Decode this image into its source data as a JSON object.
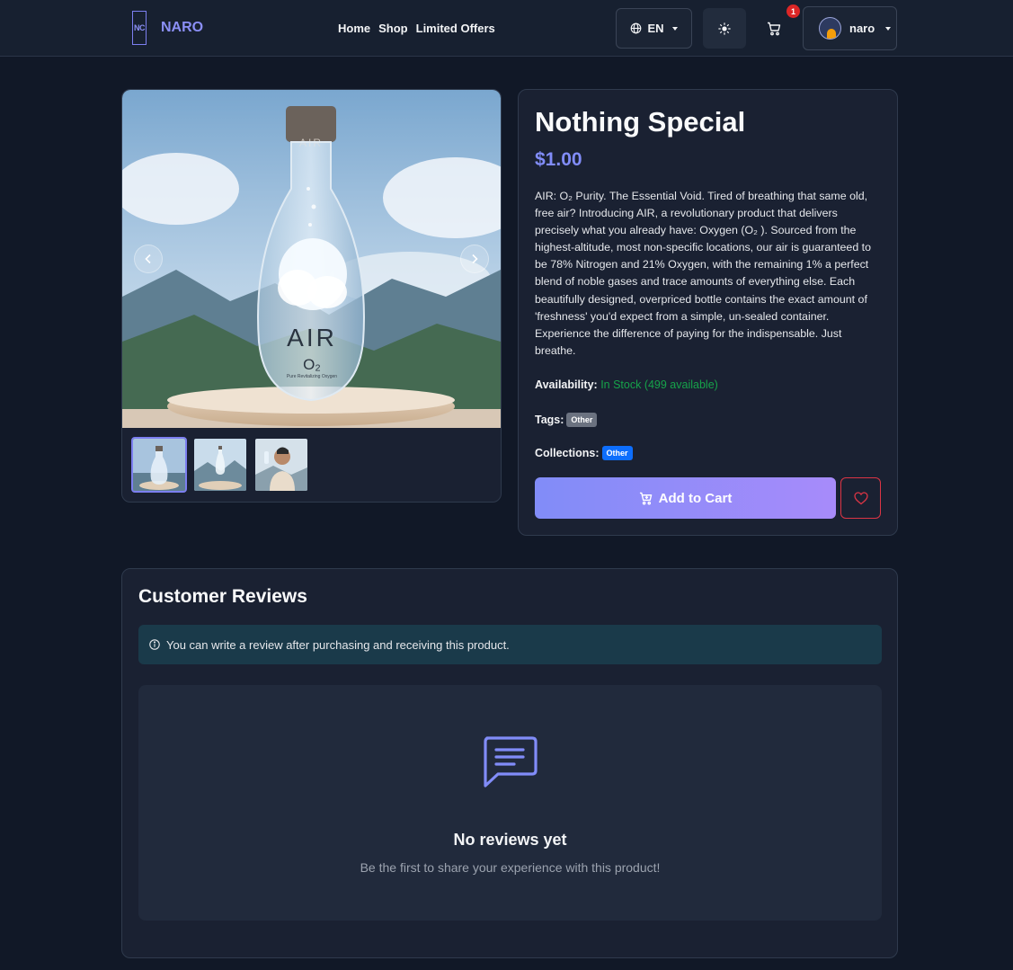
{
  "nav": {
    "logo_text": "NC",
    "brand": "NARO",
    "links": [
      "Home",
      "Shop",
      "Limited Offers"
    ],
    "language": "EN",
    "cart_count": "1",
    "username": "naro"
  },
  "product": {
    "title": "Nothing Special",
    "price": "$1.00",
    "description": "AIR: O₂ Purity. The Essential Void. Tired of breathing that same old, free air? Introducing AIR, a revolutionary product that delivers precisely what you already have: Oxygen (O₂ ). Sourced from the highest-altitude, most non-specific locations, our air is guaranteed to be 78% Nitrogen and 21% Oxygen, with the remaining 1% a perfect blend of noble gases and trace amounts of everything else. Each beautifully designed, overpriced bottle contains the exact amount of 'freshness' you'd expect from a simple, un-sealed container. Experience the difference of paying for the indispensable. Just breathe.",
    "availability_label": "Availability:",
    "availability_value": "In Stock (499 available)",
    "tags_label": "Tags:",
    "tag": "Other",
    "collections_label": "Collections:",
    "collection": "Other",
    "add_to_cart": "Add to Cart",
    "image_brand_text": "AIR",
    "image_formula_text": "O₂",
    "image_tagline_text": "Pure Revitalizing Oxygen",
    "cap_text": "AIR",
    "thumbnails": [
      "bottle-on-pedestal",
      "bottle-in-mountains",
      "man-drinking"
    ]
  },
  "reviews": {
    "title": "Customer Reviews",
    "notice": "You can write a review after purchasing and receiving this product.",
    "empty_title": "No reviews yet",
    "empty_subtitle": "Be the first to share your experience with this product!"
  },
  "colors": {
    "accent": "#818cf8",
    "background": "#111827",
    "card": "#1a2132",
    "success": "#16a34a",
    "danger": "#dc3545"
  }
}
